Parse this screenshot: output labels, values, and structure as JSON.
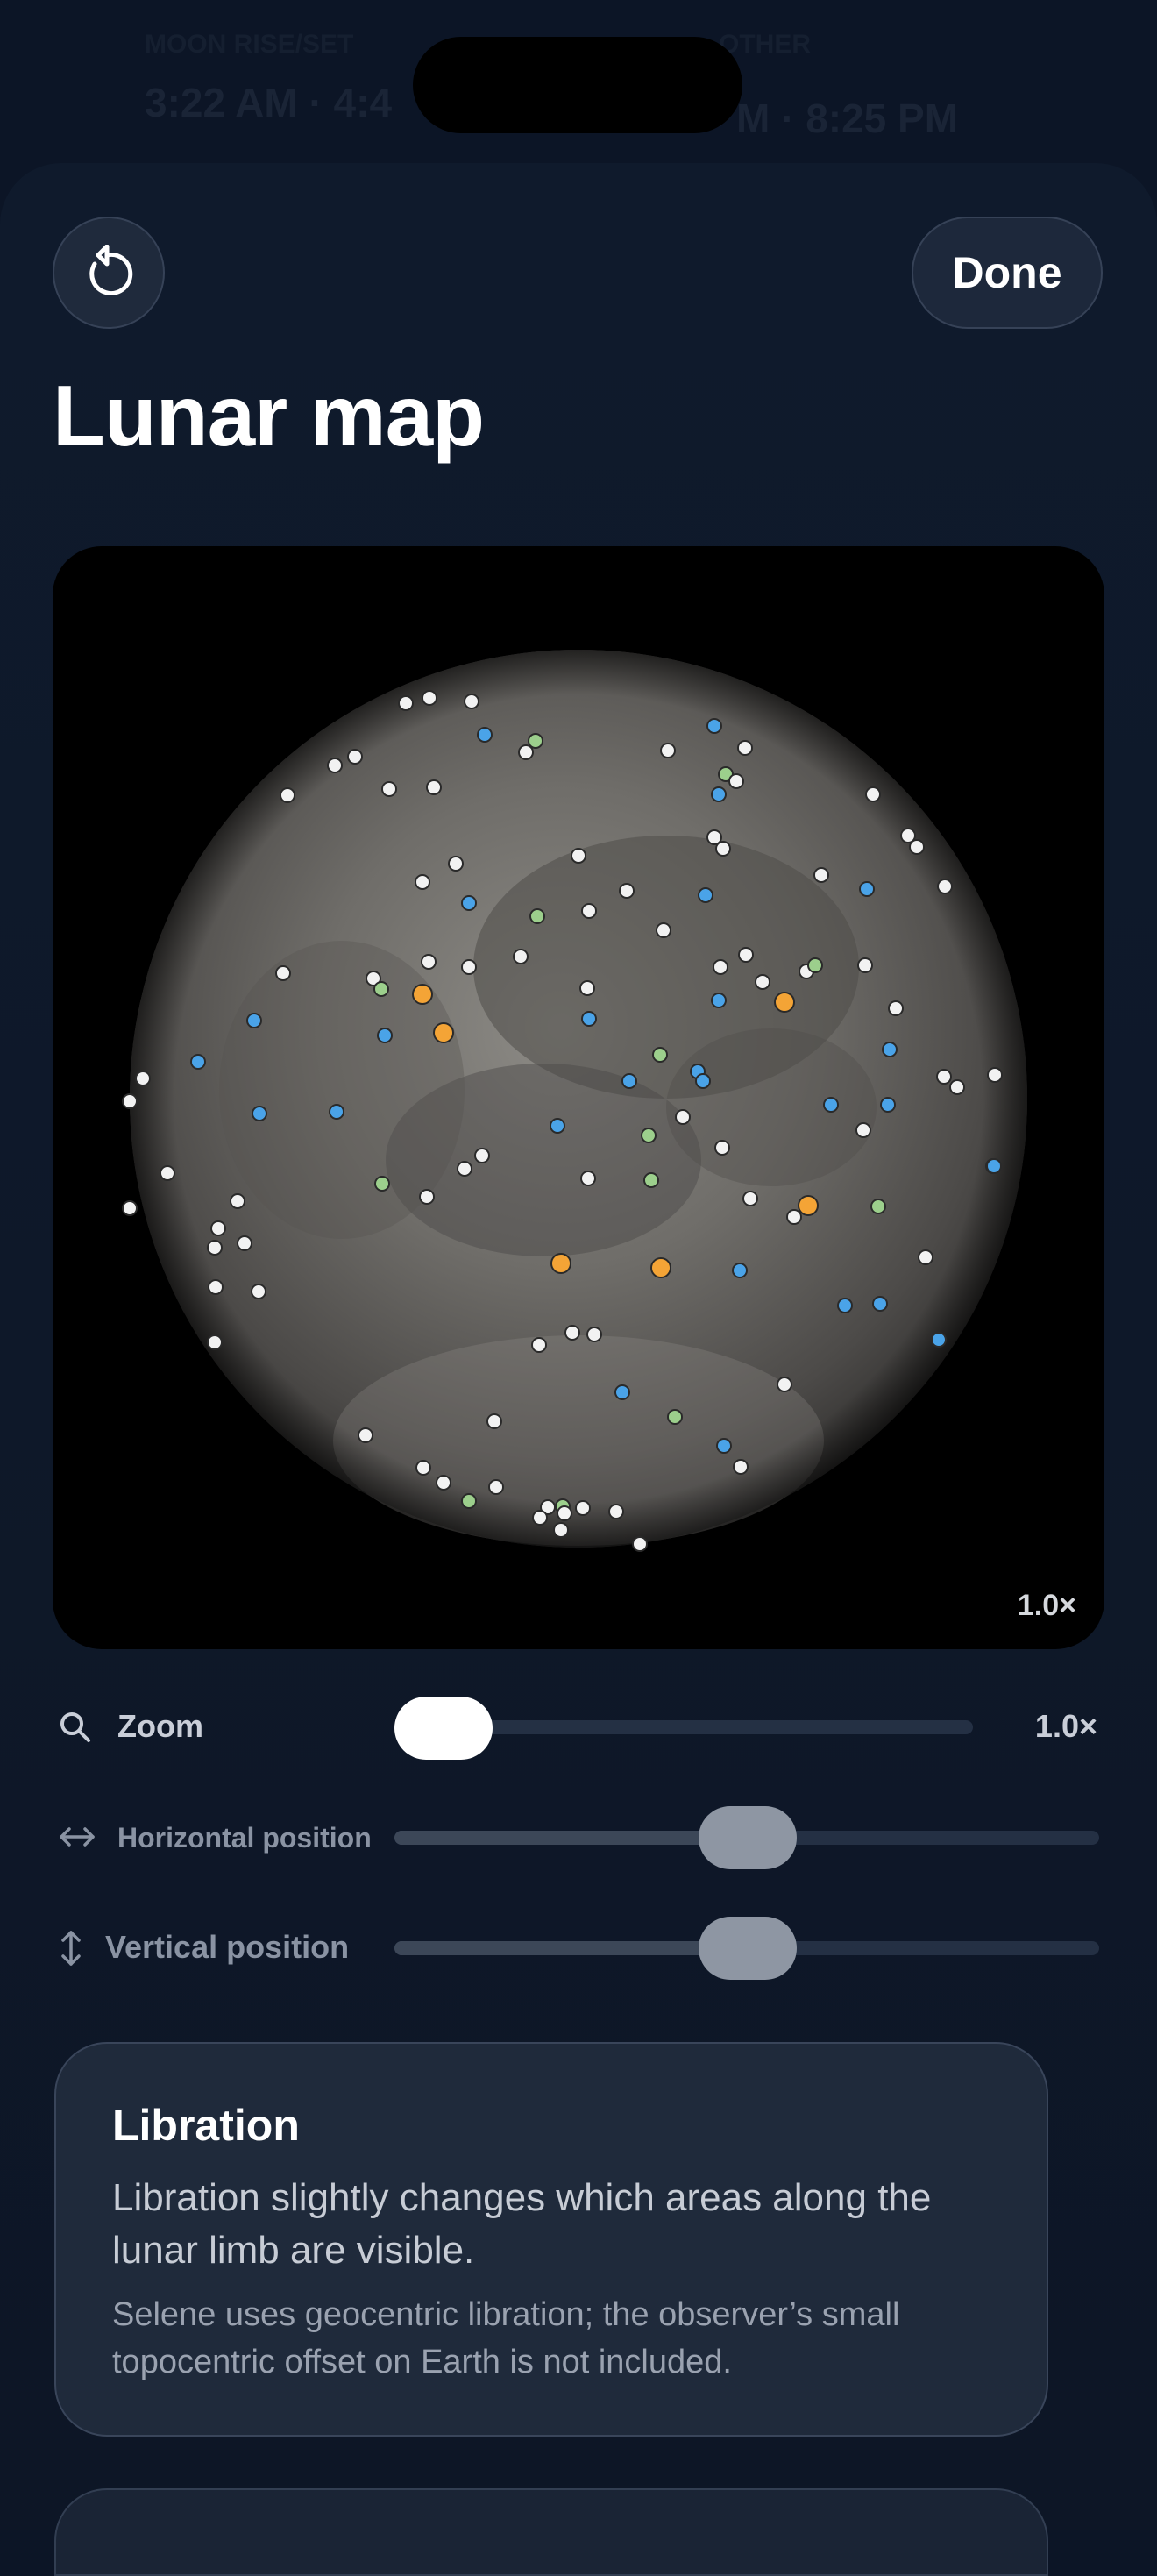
{
  "background": {
    "row1_label": "MOON RISE/SET",
    "row1_time": "3:22 AM · 4:4",
    "row2_label": "OTHER",
    "row2_time": "M · 8:25 PM"
  },
  "header": {
    "reset_icon": "arrow-counterclockwise-icon",
    "done_label": "Done"
  },
  "page_title": "Lunar map",
  "map": {
    "zoom_badge": "1.0×",
    "marker_colors": {
      "white": "#f2f2f2",
      "blue": "#4aa3e8",
      "green": "#9ccf8c",
      "orange": "#f4a436"
    }
  },
  "controls": {
    "zoom": {
      "icon": "magnifier-icon",
      "label": "Zoom",
      "value_text": "1.0×",
      "level": 0.0
    },
    "horizontal": {
      "icon": "horizontal-arrows-icon",
      "label": "Horizontal position",
      "level": 0.5
    },
    "vertical": {
      "icon": "vertical-arrows-icon",
      "label": "Vertical position",
      "level": 0.5
    }
  },
  "info": {
    "title": "Libration",
    "main": "Libration slightly changes which areas along the lunar limb are visible.",
    "note": "Selene uses geocentric libration; the observer’s small topocentric offset on Earth is not included."
  }
}
